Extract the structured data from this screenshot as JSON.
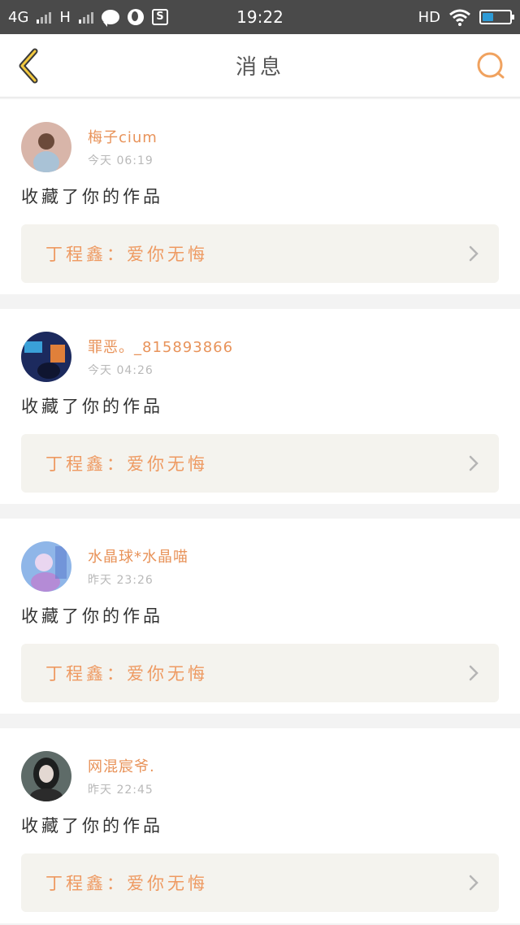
{
  "status_bar": {
    "network_1": "4G",
    "network_2": "H",
    "time": "19:22",
    "hd": "HD",
    "s_label": "S",
    "icons": [
      "signal-icon",
      "signal-icon",
      "chat-bubble-icon",
      "globe-icon",
      "s-box-icon",
      "wifi-icon",
      "battery-icon"
    ],
    "battery_level": 0.4,
    "battery_color": "#2e9bd6"
  },
  "header": {
    "title": "消息",
    "back_icon": "chevron-left-icon",
    "search_icon": "search-icon",
    "accent_color": "#f0a25f"
  },
  "messages": [
    {
      "username": "梅子cium",
      "time": "今天 06:19",
      "action": "收藏了你的作品",
      "work": "丁程鑫：爱你无悔"
    },
    {
      "username": "罪恶。_815893866",
      "time": "今天 04:26",
      "action": "收藏了你的作品",
      "work": "丁程鑫：爱你无悔"
    },
    {
      "username": "水晶球*水晶喵",
      "time": "昨天 23:26",
      "action": "收藏了你的作品",
      "work": "丁程鑫：爱你无悔"
    },
    {
      "username": "网混宸爷.",
      "time": "昨天 22:45",
      "action": "收藏了你的作品",
      "work": "丁程鑫：爱你无悔"
    }
  ]
}
